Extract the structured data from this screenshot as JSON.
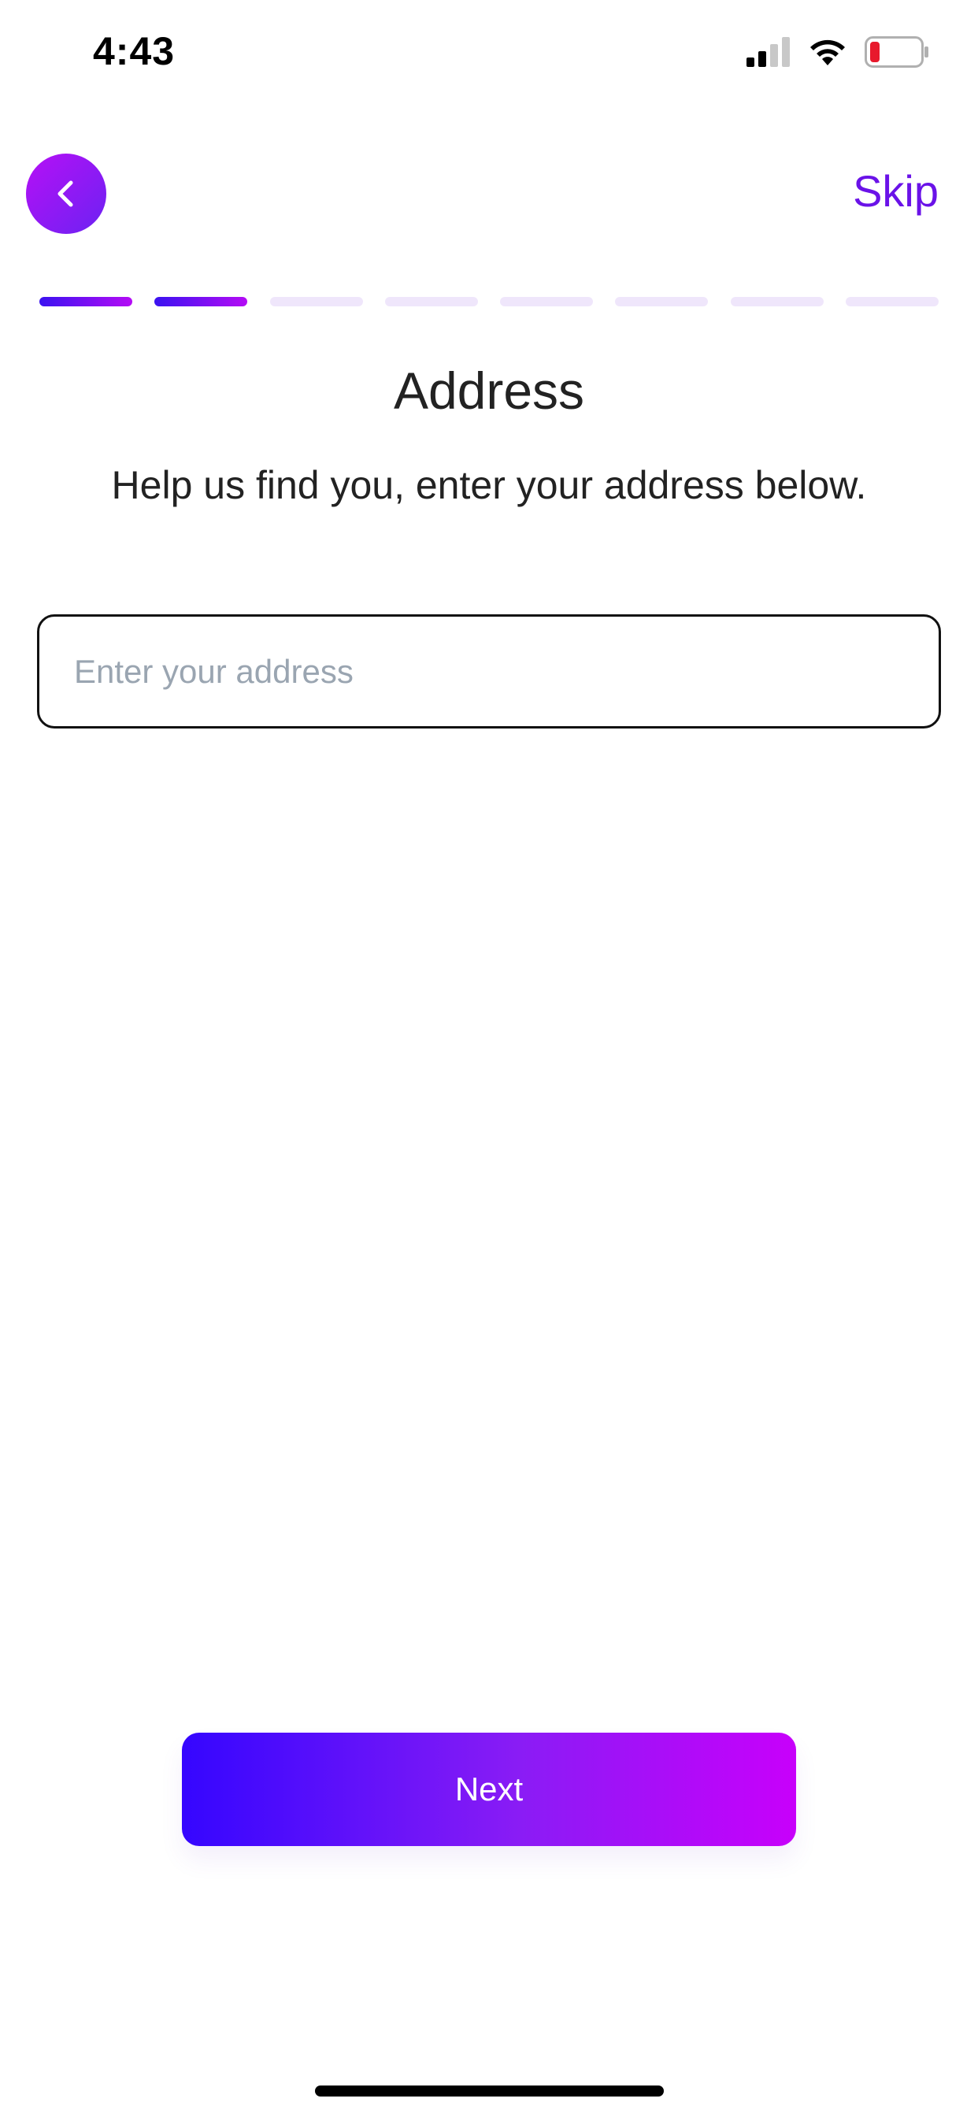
{
  "status_bar": {
    "time": "4:43",
    "icons": [
      "signal-icon",
      "wifi-icon",
      "battery-icon"
    ],
    "battery_color": "#e8192c"
  },
  "header": {
    "back_icon": "chevron-left-icon",
    "skip_label": "Skip"
  },
  "progress": {
    "total_steps": 8,
    "completed_steps": 2
  },
  "main": {
    "title": "Address",
    "subtitle": "Help us find you, enter your address below.",
    "address_input": {
      "value": "",
      "placeholder": "Enter your address"
    }
  },
  "footer": {
    "next_label": "Next"
  },
  "colors": {
    "accent": "#6a12e8",
    "gradient_start": "#3506ff",
    "gradient_end": "#c800fb",
    "progress_inactive": "#efe6fb"
  }
}
